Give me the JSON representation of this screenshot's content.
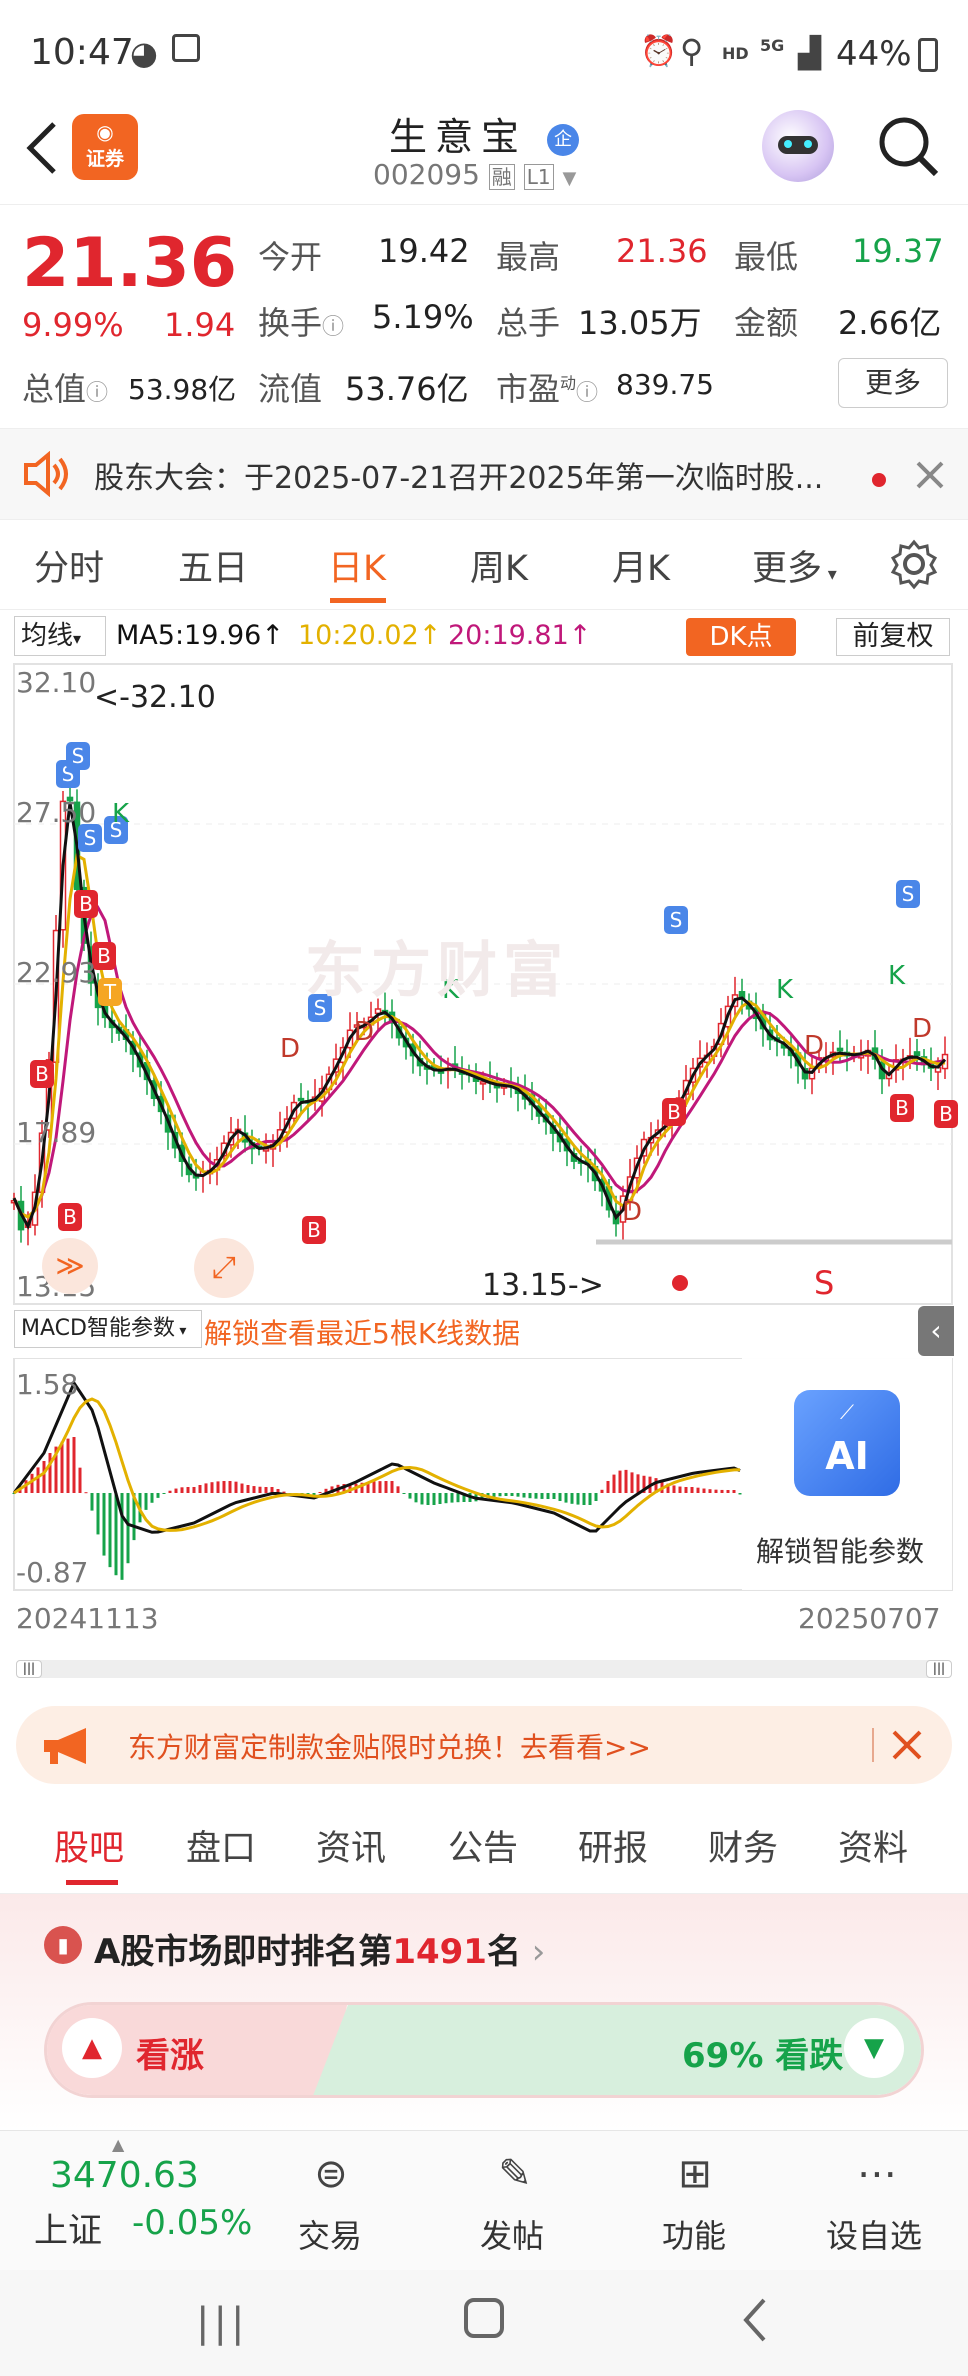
{
  "status_bar": {
    "time": "10:47",
    "battery": "44%",
    "hd": "HD",
    "net": "5G"
  },
  "header": {
    "broker_badge": "证券",
    "stock_name": "生意宝",
    "corp_tag": "企",
    "stock_code": "002095",
    "margin_tag": "融",
    "level_tag": "L1"
  },
  "quote": {
    "price": "21.36",
    "change_pct": "9.99%",
    "change": "1.94",
    "open_label": "今开",
    "open": "19.42",
    "high_label": "最高",
    "high": "21.36",
    "low_label": "最低",
    "low": "19.37",
    "turnover_label": "换手",
    "turnover": "5.19%",
    "volume_label": "总手",
    "volume": "13.05万",
    "amount_label": "金额",
    "amount": "2.66亿",
    "total_cap_label": "总值",
    "total_cap": "53.98亿",
    "float_cap_label": "流值",
    "float_cap": "53.76亿",
    "pe_label": "市盈",
    "pe_sup": "动",
    "pe": "839.75",
    "more_button": "更多"
  },
  "notice": {
    "text": "股东大会：于2025-07-21召开2025年第一次临时股..."
  },
  "chart_tabs": [
    "分时",
    "五日",
    "日K",
    "周K",
    "月K",
    "更多"
  ],
  "active_tab": "日K",
  "chart_toolbar": {
    "ma_selector": "均线",
    "ma5": "MA5:19.96",
    "ma10": "10:20.02",
    "ma20": "20:19.81",
    "dk_button": "DK点",
    "adjust_button": "前复权"
  },
  "kline": {
    "y_labels": [
      "32.10",
      "27.50",
      "22.93",
      "17.89",
      "13.15"
    ],
    "max_marker": "<-32.10",
    "min_marker": "13.15->",
    "watermark": "东方财富",
    "s_marker": "S"
  },
  "macd": {
    "selector": "MACD智能参数",
    "unlock_text": "解锁查看最近5根K线数据",
    "y_top": "1.58",
    "y_bottom": "-0.87",
    "ai_label": "AI",
    "ai_unlock": "解锁智能参数"
  },
  "dates": {
    "start": "20241113",
    "end": "20250707"
  },
  "promo": {
    "text": "东方财富定制款金贴限时兑换！去看看>>"
  },
  "content_tabs": [
    "股吧",
    "盘口",
    "资讯",
    "公告",
    "研报",
    "财务",
    "资料"
  ],
  "active_content_tab": "股吧",
  "rank": {
    "prefix": "A股市场即时排名第",
    "number": "1491",
    "suffix": "名",
    "bull_label": "看涨",
    "bear_label": "69% 看跌"
  },
  "bottom_nav": {
    "index_value": "3470.63",
    "index_name": "上证",
    "index_change": "-0.05%",
    "items": [
      "交易",
      "发帖",
      "功能",
      "设自选"
    ]
  },
  "colors": {
    "up": "#e0262e",
    "down": "#16a34a",
    "accent": "#f26522",
    "ma5": "#111111",
    "ma10": "#e3b100",
    "ma20": "#c0187a"
  }
}
